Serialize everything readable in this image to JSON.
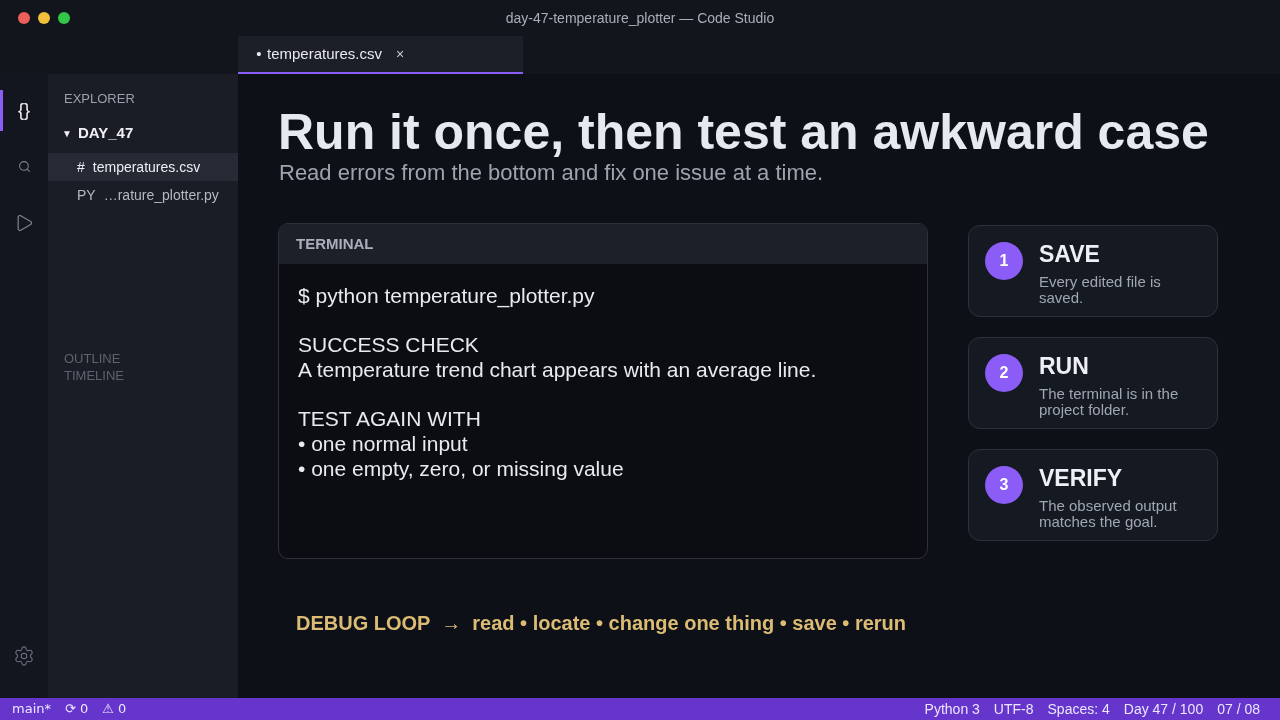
{
  "window": {
    "title": "day-47-temperature_plotter — Code Studio"
  },
  "tabs": [
    {
      "modified_mark": "•",
      "label": "temperatures.csv",
      "close": "×",
      "selected": true
    }
  ],
  "activity_bar": {
    "items": [
      {
        "kind": "braces",
        "glyph": "{}",
        "selected": true
      },
      {
        "kind": "search",
        "selected": false
      },
      {
        "kind": "run",
        "selected": false
      }
    ]
  },
  "sidebar": {
    "title": "EXPLORER",
    "folder": {
      "caret": "▼",
      "name": "DAY_47",
      "expanded": true,
      "children": [
        {
          "type_label": "#",
          "name": "temperatures.csv",
          "selected": true
        },
        {
          "type_label": "PY",
          "name": "…rature_plotter.py",
          "selected": false
        }
      ]
    },
    "sections": [
      "OUTLINE",
      "TIMELINE"
    ]
  },
  "content": {
    "heading": "Run it once, then test an awkward case",
    "subtitle": "Read errors from the bottom and fix one issue at a time.",
    "terminal": {
      "title": "TERMINAL",
      "blocks": [
        {
          "lines": [
            "$ python temperature_plotter.py"
          ]
        },
        {
          "lines": [
            "SUCCESS CHECK",
            "A temperature trend chart appears with an average line."
          ]
        },
        {
          "lines": [
            "TEST AGAIN WITH",
            "• one normal input",
            "• one empty, zero, or missing value"
          ]
        }
      ]
    },
    "steps": [
      {
        "number": "1",
        "title": "SAVE",
        "description": "Every edited file is saved."
      },
      {
        "number": "2",
        "title": "RUN",
        "description": "The terminal is in the project folder."
      },
      {
        "number": "3",
        "title": "VERIFY",
        "description": "The observed output matches the goal."
      }
    ],
    "footer_note": "DEBUG LOOP  →  read • locate • change one thing • save • rerun"
  },
  "status_bar": {
    "left": [
      "main*",
      "⟳ 0",
      "⚠ 0"
    ],
    "right": [
      "Python 3",
      "UTF-8",
      "Spaces: 4",
      "Day 47 / 100",
      "07 / 08"
    ]
  }
}
